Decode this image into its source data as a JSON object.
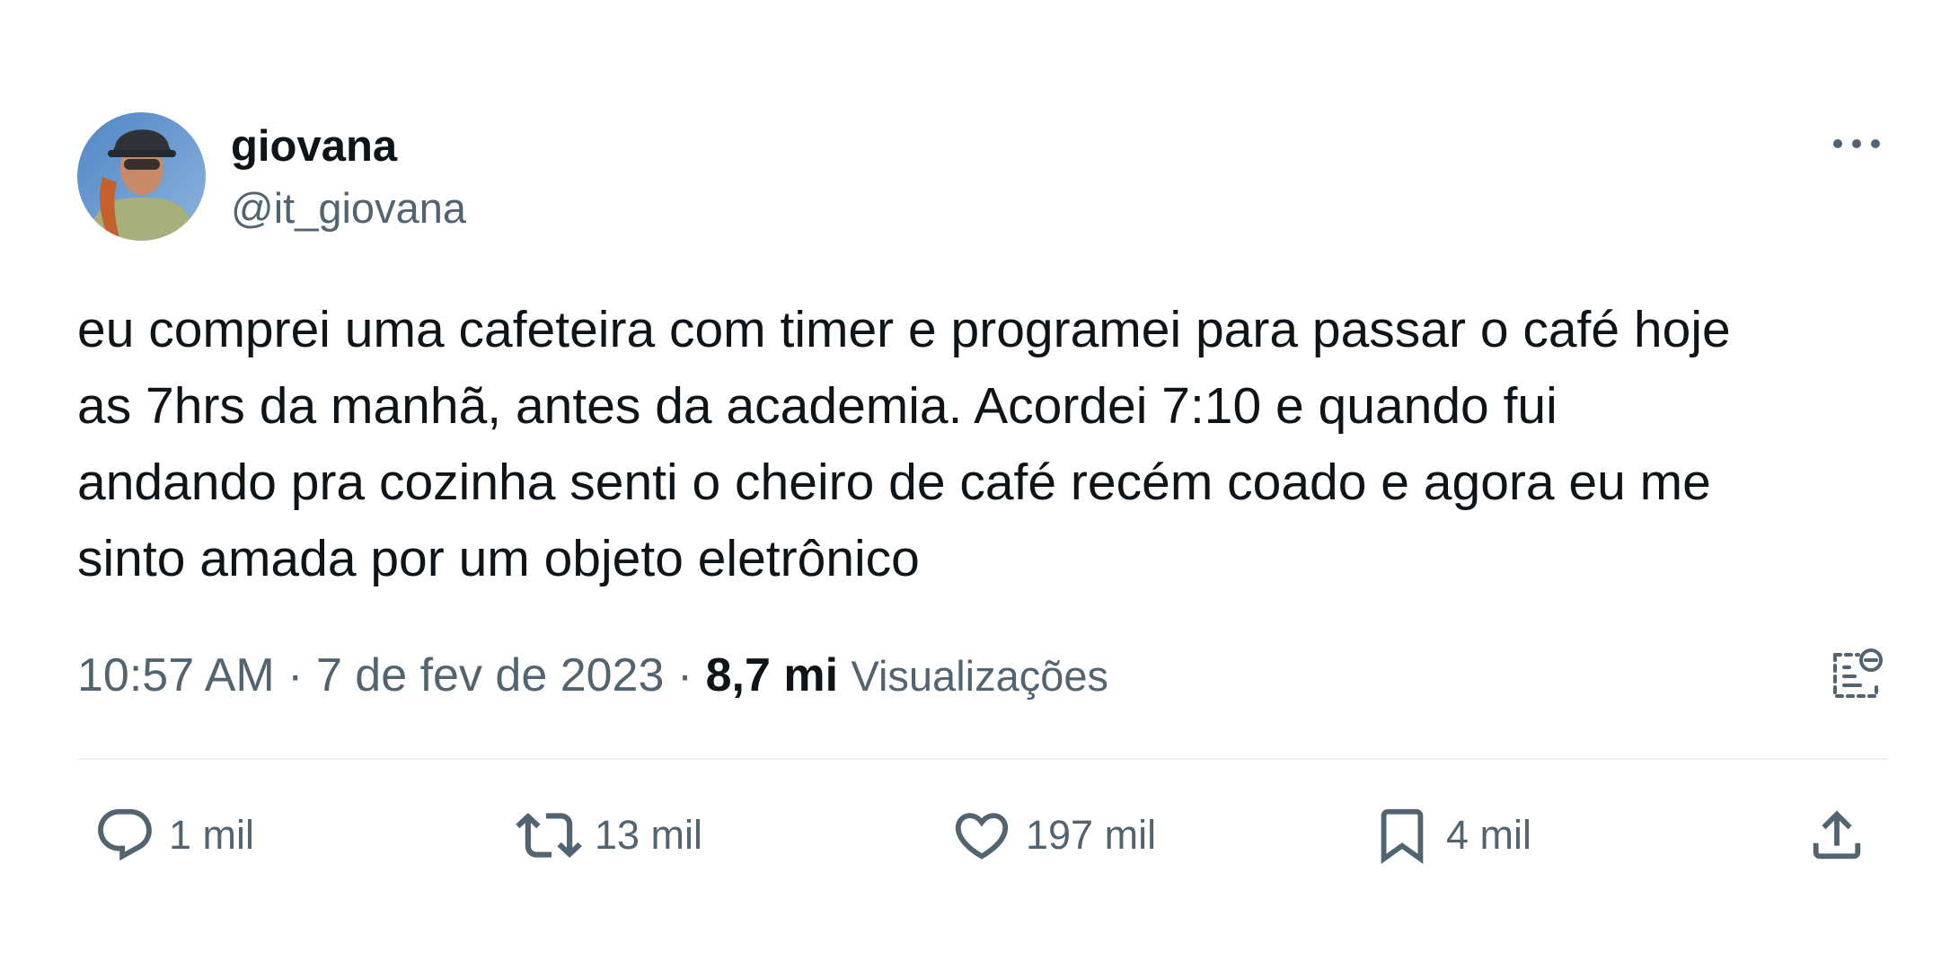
{
  "author": {
    "display_name": "giovana",
    "handle": "@it_giovana",
    "avatar_icon": "profile-photo"
  },
  "tweet": {
    "text_lines": [
      "eu comprei uma cafeteira com timer e programei para passar o café hoje",
      "as 7hrs da manhã, antes da academia. Acordei 7:10 e quando fui",
      "andando pra cozinha senti o cheiro de café recém coado e agora eu me",
      "sinto amada por um objeto eletrônico"
    ],
    "time": "10:57 AM",
    "date": "7 de fev de 2023",
    "separator": " · ",
    "views_count": "8,7 mi",
    "views_label": "Visualizações"
  },
  "actions": {
    "reply": {
      "icon": "reply-icon",
      "count": "1 mil"
    },
    "retweet": {
      "icon": "retweet-icon",
      "count": "13 mil"
    },
    "like": {
      "icon": "heart-icon",
      "count": "197 mil"
    },
    "bookmark": {
      "icon": "bookmark-icon",
      "count": "4 mil"
    },
    "share": {
      "icon": "share-icon"
    }
  },
  "colors": {
    "text": "#0f1419",
    "secondary": "#536471",
    "divider": "#eff3f4"
  }
}
